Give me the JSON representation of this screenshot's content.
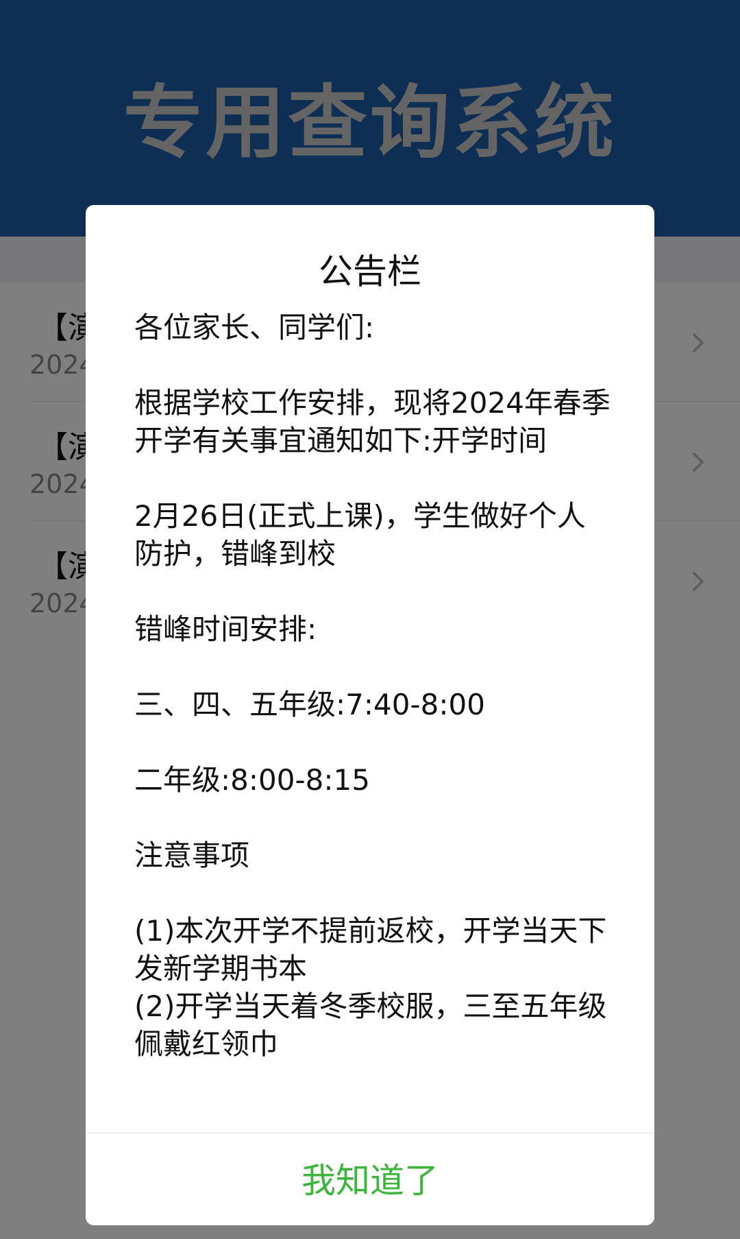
{
  "header": {
    "title": "专用查询系统"
  },
  "list": {
    "items": [
      {
        "title": "【演",
        "date": "2024"
      },
      {
        "title": "【演",
        "date": "2024"
      },
      {
        "title": "【演",
        "date": "2024"
      }
    ]
  },
  "dialog": {
    "title": "公告栏",
    "paragraphs": [
      "各位家长、同学们:",
      "根据学校工作安排，现将2024年春季开学有关事宜通知如下:开学时间",
      "2月26日(正式上课)，学生做好个人防护，错峰到校",
      "错峰时间安排:",
      "三、四、五年级:7:40-8:00",
      "二年级:8:00-8:15",
      "注意事项",
      "(1)本次开学不提前返校，开学当天下发新学期书本",
      "(2)开学当天着冬季校服，三至五年级佩戴红领巾"
    ],
    "confirm_label": "我知道了"
  },
  "colors": {
    "header_bg": "#1d5da6",
    "header_text": "#c8c8c8",
    "confirm_text": "#3cb63a"
  }
}
